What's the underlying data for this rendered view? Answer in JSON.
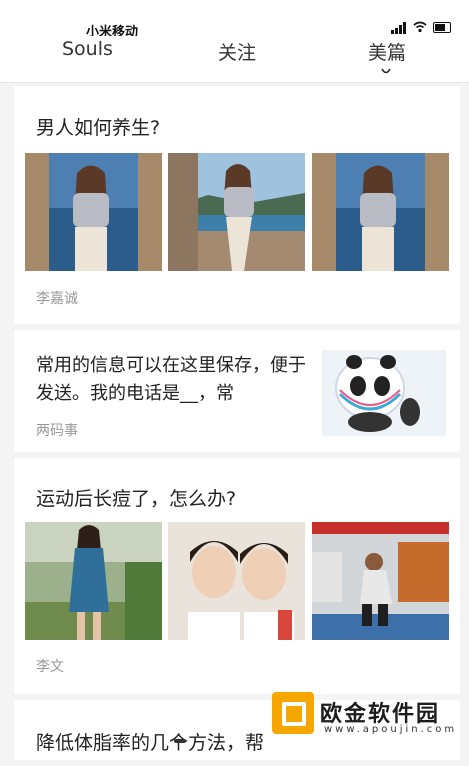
{
  "status_bar": {
    "carrier": "小米移动"
  },
  "tabs": [
    {
      "label": "Souls"
    },
    {
      "label": "关注"
    },
    {
      "label": "美篇"
    }
  ],
  "feed": [
    {
      "title": "男人如何养生?",
      "author": "李嘉诚",
      "images": [
        "portrait-coast-1",
        "portrait-coast-2",
        "portrait-coast-3"
      ]
    },
    {
      "title": "常用的信息可以在这里保存，便于发送。我的电话是__，常",
      "author": "两码事",
      "thumbnail": "panda-mascot"
    },
    {
      "title": "运动后长痘了，怎么办?",
      "author": "李文",
      "images": [
        "woman-blue-dress",
        "two-women-smiling",
        "man-locker-room"
      ]
    },
    {
      "title": "降低体脂率的几个方法，帮"
    }
  ],
  "watermark": {
    "text": "欧金软件园",
    "url": "www.apoujin.com"
  },
  "colors": {
    "accent": "#f5a700",
    "text": "#222222",
    "muted": "#999999"
  }
}
